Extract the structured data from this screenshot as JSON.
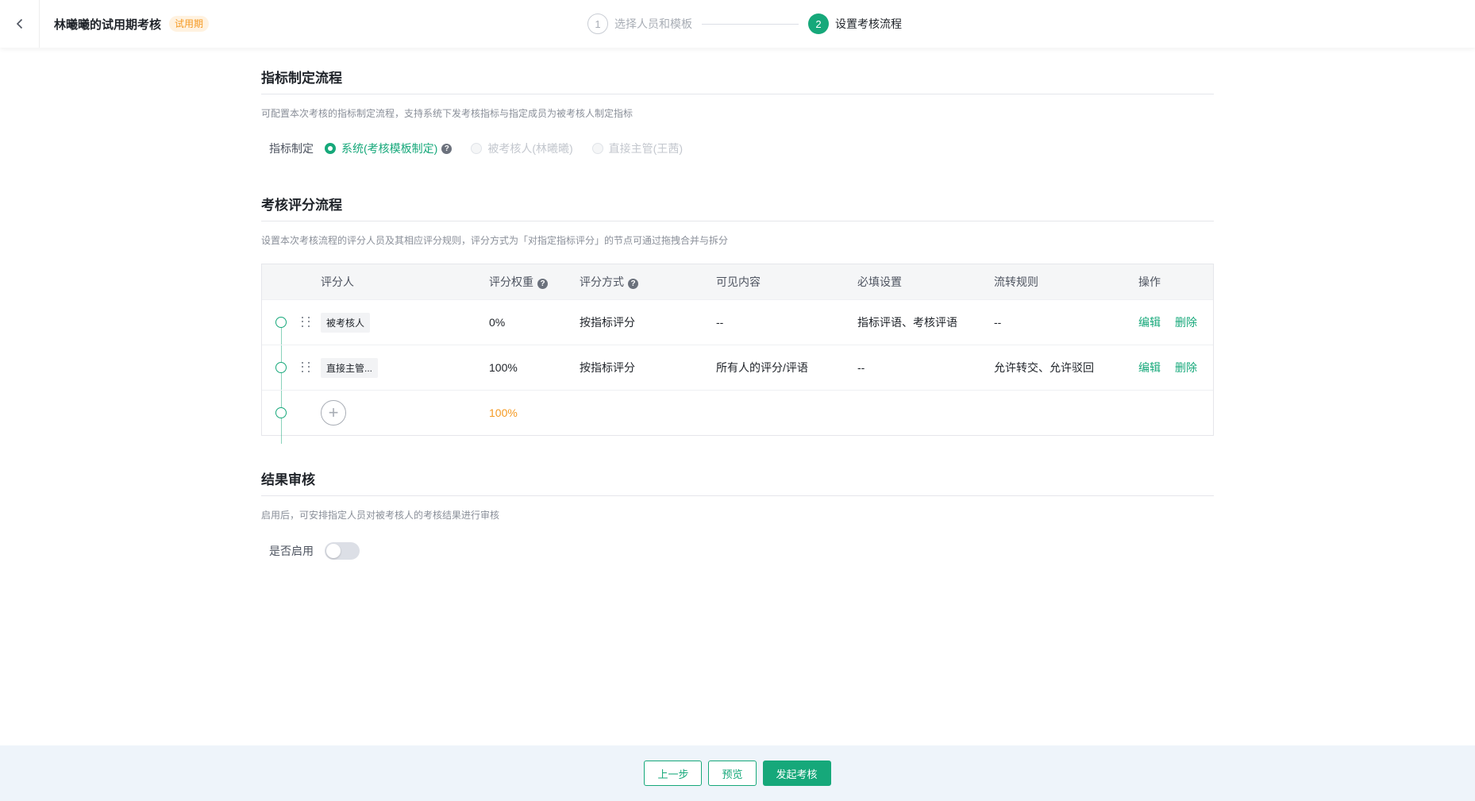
{
  "header": {
    "title": "林曦曦的试用期考核",
    "badge": "试用期",
    "steps": [
      {
        "num": "1",
        "label": "选择人员和模板",
        "state": "inactive"
      },
      {
        "num": "2",
        "label": "设置考核流程",
        "state": "active"
      }
    ]
  },
  "indicator": {
    "title": "指标制定流程",
    "desc": "可配置本次考核的指标制定流程，支持系统下发考核指标与指定成员为被考核人制定指标",
    "field_label": "指标制定",
    "options": [
      {
        "label": "系统(考核模板制定)",
        "state": "checked"
      },
      {
        "label": "被考核人(林曦曦)",
        "state": "disabled"
      },
      {
        "label": "直接主管(王茜)",
        "state": "disabled"
      }
    ]
  },
  "scoring": {
    "title": "考核评分流程",
    "desc": "设置本次考核流程的评分人员及其相应评分规则，评分方式为「对指定指标评分」的节点可通过拖拽合并与拆分",
    "columns": [
      "评分人",
      "评分权重",
      "评分方式",
      "可见内容",
      "必填设置",
      "流转规则",
      "操作"
    ],
    "rows": [
      {
        "rater": "被考核人",
        "weight": "0%",
        "method": "按指标评分",
        "visible": "--",
        "required": "指标评语、考核评语",
        "flow": "--",
        "edit": "编辑",
        "delete": "删除"
      },
      {
        "rater": "直接主管...",
        "weight": "100%",
        "method": "按指标评分",
        "visible": "所有人的评分/评语",
        "required": "--",
        "flow": "允许转交、允许驳回",
        "edit": "编辑",
        "delete": "删除"
      }
    ],
    "total_weight": "100%"
  },
  "review": {
    "title": "结果审核",
    "desc": "启用后，可安排指定人员对被考核人的考核结果进行审核",
    "field_label": "是否启用",
    "enabled": false
  },
  "footer": {
    "prev": "上一步",
    "preview": "预览",
    "submit": "发起考核"
  },
  "colors": {
    "accent": "#16a87a",
    "warning": "#f59a23"
  }
}
